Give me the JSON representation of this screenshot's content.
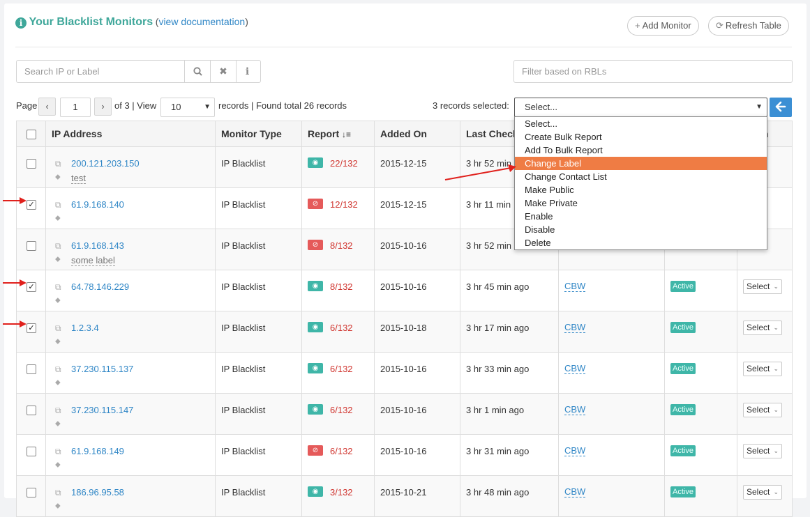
{
  "header": {
    "info_icon": "i",
    "title": "Your Blacklist Monitors",
    "paren_open": "(",
    "doc_link": "view documentation",
    "paren_close": ")",
    "add_monitor": "Add Monitor",
    "refresh_table": "Refresh Table"
  },
  "search": {
    "placeholder": "Search IP or Label",
    "rbl_placeholder": "Filter based on RBLs"
  },
  "pagination": {
    "page_label": "Page",
    "page_value": "1",
    "of_text": "of 3 | View",
    "view_value": "10",
    "records_text": "records | Found total 26 records"
  },
  "bulk": {
    "selected_text": "3 records selected:",
    "current": "Select...",
    "options": [
      "Select...",
      "Create Bulk Report",
      "Add To Bulk Report",
      "Change Label",
      "Change Contact List",
      "Make Public",
      "Make Private",
      "Enable",
      "Disable",
      "Delete"
    ],
    "highlighted_index": 3
  },
  "table": {
    "headers": {
      "ip": "IP Address",
      "type": "Monitor Type",
      "report": "Report",
      "added": "Added On",
      "last": "Last Check",
      "action": "n"
    },
    "rows": [
      {
        "checked": false,
        "ip": "200.121.203.150",
        "label": "test",
        "type": "IP Blacklist",
        "listed": false,
        "report": "22/132",
        "added": "2015-12-15",
        "last": "3 hr 52 min",
        "contact": "",
        "status": "",
        "action": ""
      },
      {
        "checked": true,
        "ip": "61.9.168.140",
        "label": "",
        "type": "IP Blacklist",
        "listed": true,
        "report": "12/132",
        "added": "2015-12-15",
        "last": "3 hr 11 min",
        "contact": "",
        "status": "",
        "action": ""
      },
      {
        "checked": false,
        "ip": "61.9.168.143",
        "label": "some label",
        "type": "IP Blacklist",
        "listed": true,
        "report": "8/132",
        "added": "2015-10-16",
        "last": "3 hr 52 min",
        "contact": "",
        "status": "",
        "action": ""
      },
      {
        "checked": true,
        "ip": "64.78.146.229",
        "label": "",
        "type": "IP Blacklist",
        "listed": false,
        "report": "8/132",
        "added": "2015-10-16",
        "last": "3 hr 45 min ago",
        "contact": "CBW",
        "status": "Active",
        "action": "Select"
      },
      {
        "checked": true,
        "ip": "1.2.3.4",
        "label": "",
        "type": "IP Blacklist",
        "listed": false,
        "report": "6/132",
        "added": "2015-10-18",
        "last": "3 hr 17 min ago",
        "contact": "CBW",
        "status": "Active",
        "action": "Select"
      },
      {
        "checked": false,
        "ip": "37.230.115.137",
        "label": "",
        "type": "IP Blacklist",
        "listed": false,
        "report": "6/132",
        "added": "2015-10-16",
        "last": "3 hr 33 min ago",
        "contact": "CBW",
        "status": "Active",
        "action": "Select"
      },
      {
        "checked": false,
        "ip": "37.230.115.147",
        "label": "",
        "type": "IP Blacklist",
        "listed": false,
        "report": "6/132",
        "added": "2015-10-16",
        "last": "3 hr 1 min ago",
        "contact": "CBW",
        "status": "Active",
        "action": "Select"
      },
      {
        "checked": false,
        "ip": "61.9.168.149",
        "label": "",
        "type": "IP Blacklist",
        "listed": true,
        "report": "6/132",
        "added": "2015-10-16",
        "last": "3 hr 31 min ago",
        "contact": "CBW",
        "status": "Active",
        "action": "Select"
      },
      {
        "checked": false,
        "ip": "186.96.95.58",
        "label": "",
        "type": "IP Blacklist",
        "listed": false,
        "report": "3/132",
        "added": "2015-10-21",
        "last": "3 hr 48 min ago",
        "contact": "CBW",
        "status": "Active",
        "action": "Select"
      }
    ]
  },
  "colors": {
    "accent": "#3fa79a",
    "link": "#2f86c6",
    "danger": "#d0352f",
    "highlight": "#ef7c44",
    "primary_button": "#3b8fd4",
    "annotation_arrow": "#e0201c"
  }
}
